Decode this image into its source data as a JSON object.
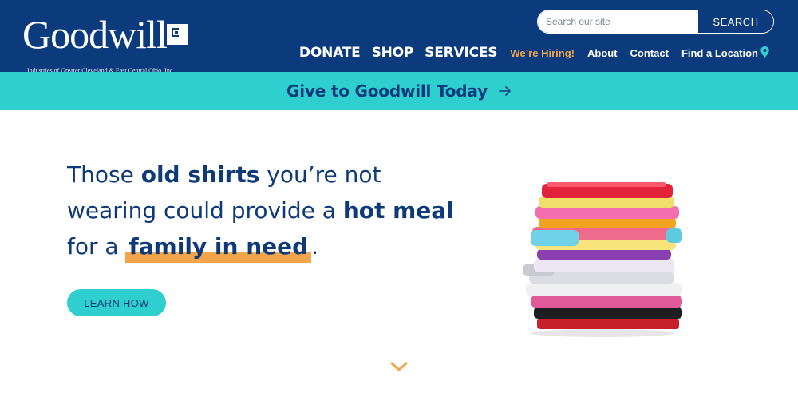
{
  "header": {
    "logo_word": "Goodwill",
    "logo_subtitle": "Industries of Greater Cleveland & East Central Ohio, Inc.",
    "search": {
      "placeholder": "Search our site",
      "button_label": "SEARCH"
    },
    "nav_main": [
      "DONATE",
      "SHOP",
      "SERVICES"
    ],
    "nav_hiring": "We’re Hiring!",
    "nav_secondary": [
      "About",
      "Contact",
      "Find a Location"
    ]
  },
  "banner": {
    "text": "Give to Goodwill Today",
    "icon": "arrow-right-icon"
  },
  "hero": {
    "line1_a": "Those ",
    "line1_b": "old shirts",
    "line1_c": " you’re not",
    "line2_a": "wearing could provide a ",
    "line2_b": "hot meal",
    "line3_a": "for a ",
    "line3_b": "family in need",
    "line3_c": ".",
    "cta_label": "LEARN HOW",
    "image": "folded-shirts-stack"
  },
  "footer_hint": {
    "icon": "chevron-down-icon"
  },
  "colors": {
    "navy": "#0b3b7c",
    "teal": "#2fcfcf",
    "orange": "#f2a54a",
    "text_blue": "#0f3a78"
  }
}
